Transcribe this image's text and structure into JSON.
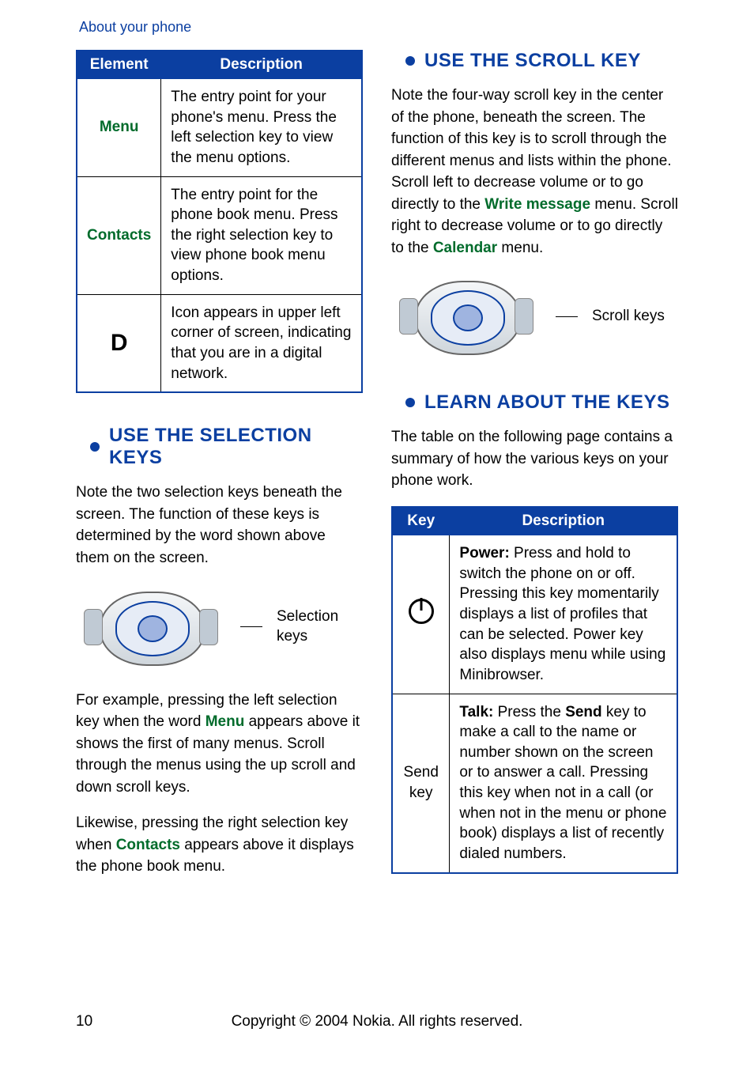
{
  "header": {
    "title": "About your phone"
  },
  "table1": {
    "headers": [
      "Element",
      "Description"
    ],
    "rows": [
      {
        "key": "Menu",
        "desc": "The entry point for your phone's menu. Press the left selection key to view the menu options."
      },
      {
        "key": "Contacts",
        "desc": "The entry point for the phone book menu. Press the right selection key to view phone book menu options."
      },
      {
        "key": "D",
        "desc": "Icon appears in upper left corner of screen, indicating that you are in a digital network."
      }
    ]
  },
  "section_selection": {
    "heading": "USE THE SELECTION KEYS",
    "p1": "Note the two selection keys beneath the screen. The function of these keys is determined by the word shown above them on the screen.",
    "caption": "Selection keys",
    "p2a": "For example, pressing the left selection key when the word ",
    "p2_menu": "Menu",
    "p2b": " appears above it shows the first of many menus. Scroll through the menus using the up scroll and down scroll keys.",
    "p3a": "Likewise, pressing the right selection key when ",
    "p3_contacts": "Contacts",
    "p3b": " appears above it displays the phone book menu."
  },
  "section_scroll": {
    "heading": "USE THE SCROLL KEY",
    "p1a": "Note the four-way scroll key in the center of the phone, beneath the screen. The function of this key is to scroll through the different menus and lists within the phone. Scroll left to decrease volume or to go directly to the ",
    "p1_write": "Write message",
    "p1b": " menu. Scroll right to decrease volume or to go directly to the ",
    "p1_cal": "Calendar",
    "p1c": " menu.",
    "caption": "Scroll keys"
  },
  "section_learn": {
    "heading": "LEARN ABOUT THE KEYS",
    "p1": "The table on the following page contains a summary of how the various keys on your phone work."
  },
  "table2": {
    "headers": [
      "Key",
      "Description"
    ],
    "rows": [
      {
        "key_icon": "power",
        "desc_bold": "Power:",
        "desc": " Press and hold to switch the phone on or off. Pressing this key momentarily displays a list of profiles that can be selected. Power key also displays menu while using Minibrowser."
      },
      {
        "key_text": "Send key",
        "desc_bold1": "Talk:",
        "desc_mid1": " Press the ",
        "desc_bold2": "Send",
        "desc_mid2": " key to make a call to the name or number shown on the screen or to answer a call. Pressing this key when not in a call (or when not in the menu or phone book) displays a list of recently dialed numbers."
      }
    ]
  },
  "footer": {
    "page": "10",
    "copyright": "Copyright © 2004 Nokia. All rights reserved."
  }
}
